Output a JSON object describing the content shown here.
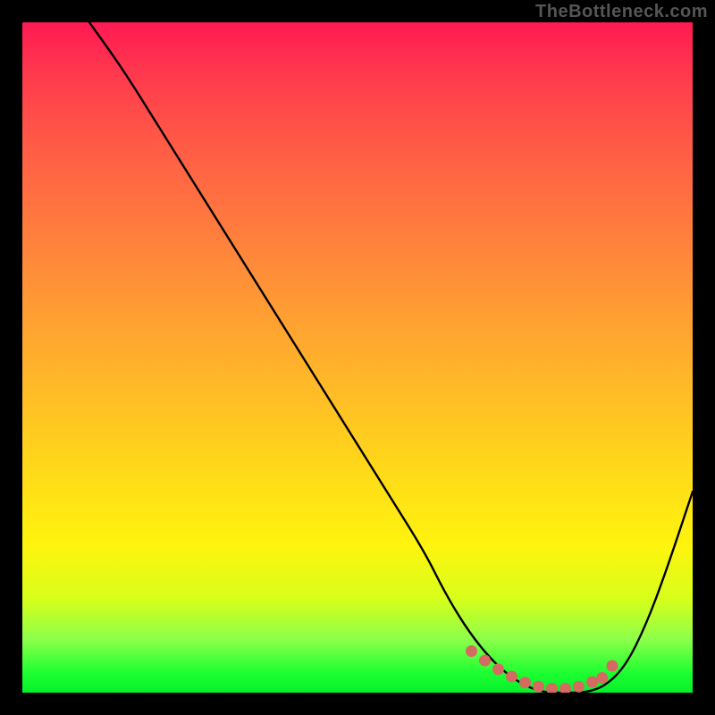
{
  "watermark": "TheBottleneck.com",
  "chart_data": {
    "type": "line",
    "title": "",
    "xlabel": "",
    "ylabel": "",
    "xlim": [
      0,
      100
    ],
    "ylim": [
      0,
      100
    ],
    "series": [
      {
        "name": "bottleneck-curve",
        "x": [
          10,
          15,
          20,
          25,
          30,
          35,
          40,
          45,
          50,
          55,
          60,
          63,
          66,
          69,
          72,
          75,
          78,
          81,
          84,
          87,
          90,
          93,
          96,
          100
        ],
        "y": [
          100,
          93,
          85,
          77,
          69,
          61,
          53,
          45,
          37,
          29,
          21,
          15,
          10,
          6,
          3,
          1,
          0,
          0,
          0,
          1,
          4,
          10,
          18,
          30
        ]
      }
    ],
    "marker_cluster": {
      "name": "optimal-range-dots",
      "color": "#d56a61",
      "points": [
        {
          "x": 67,
          "y": 6.2
        },
        {
          "x": 69,
          "y": 4.8
        },
        {
          "x": 71,
          "y": 3.5
        },
        {
          "x": 73,
          "y": 2.4
        },
        {
          "x": 75,
          "y": 1.5
        },
        {
          "x": 77,
          "y": 0.9
        },
        {
          "x": 79,
          "y": 0.6
        },
        {
          "x": 81,
          "y": 0.6
        },
        {
          "x": 83,
          "y": 0.9
        },
        {
          "x": 85,
          "y": 1.6
        },
        {
          "x": 86.5,
          "y": 2.2
        },
        {
          "x": 88,
          "y": 4.0
        }
      ]
    }
  }
}
